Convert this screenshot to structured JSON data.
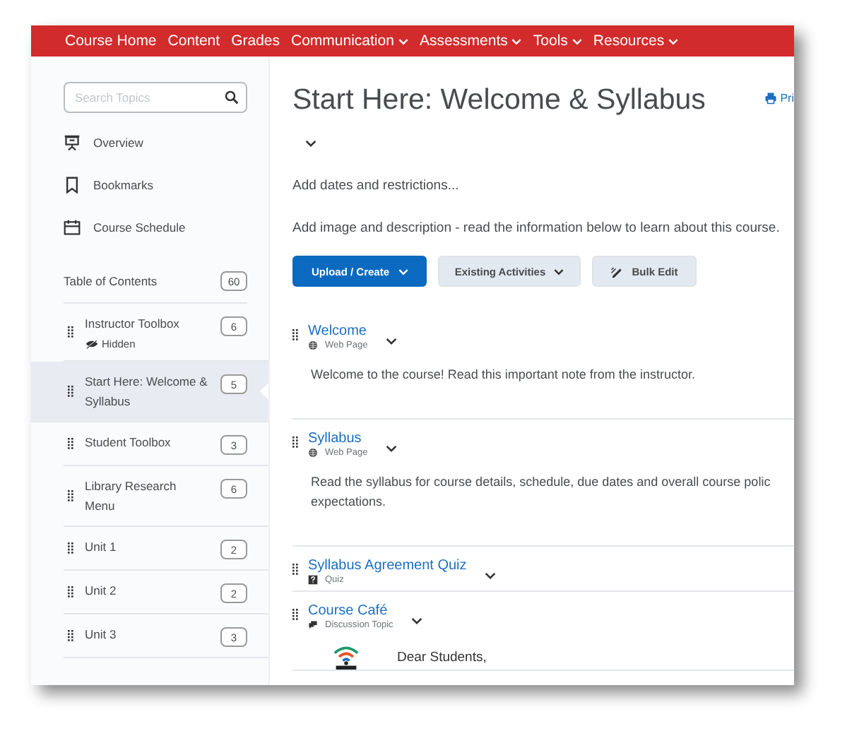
{
  "nav": [
    {
      "label": "Course Home",
      "menu": false
    },
    {
      "label": "Content",
      "menu": false
    },
    {
      "label": "Grades",
      "menu": false
    },
    {
      "label": "Communication",
      "menu": true
    },
    {
      "label": "Assessments",
      "menu": true
    },
    {
      "label": "Tools",
      "menu": true
    },
    {
      "label": "Resources",
      "menu": true
    }
  ],
  "sidebar": {
    "search": {
      "placeholder": "Search Topics"
    },
    "links": [
      {
        "label": "Overview",
        "kind": "presentation"
      },
      {
        "label": "Bookmarks",
        "kind": "bookmark"
      },
      {
        "label": "Course Schedule",
        "kind": "calendar"
      }
    ],
    "toc": {
      "label": "Table of Contents",
      "count": "60"
    },
    "modules": [
      {
        "label": "Instructor Toolbox",
        "count": "6",
        "hidden_label": "Hidden",
        "selected": false
      },
      {
        "label": "Start Here: Welcome & Syllabus",
        "count": "5",
        "selected": true
      },
      {
        "label": "Student Toolbox",
        "count": "3",
        "selected": false
      },
      {
        "label": "Library Research Menu",
        "count": "6",
        "selected": false
      },
      {
        "label": "Unit 1",
        "count": "2",
        "selected": false
      },
      {
        "label": "Unit 2",
        "count": "2",
        "selected": false
      },
      {
        "label": "Unit 3",
        "count": "3",
        "selected": false
      }
    ]
  },
  "main": {
    "title": "Start Here: Welcome & Syllabus",
    "print_label": "Pri",
    "dates_link": "Add dates and restrictions...",
    "description": "Add image and description -  read the information below to learn about this course.",
    "buttons": [
      {
        "label": "Upload / Create",
        "kind": "primary",
        "menu": true
      },
      {
        "label": "Existing Activities",
        "kind": "secondary",
        "menu": true
      },
      {
        "label": "Bulk Edit",
        "kind": "edit",
        "menu": false
      }
    ],
    "topics": [
      {
        "title": "Welcome",
        "type": "Web Page",
        "kind": "web",
        "lines": [
          "Welcome to the course! Read this important note from the instructor."
        ]
      },
      {
        "title": "Syllabus",
        "type": "Web Page",
        "kind": "web",
        "lines": [
          "Read the syllabus for course details, schedule, due dates and overall course polic",
          "expectations."
        ]
      },
      {
        "title": "Syllabus Agreement Quiz",
        "type": "Quiz",
        "kind": "quiz"
      },
      {
        "title": "Course Café",
        "type": "Discussion Topic",
        "kind": "discussion",
        "greeting": "Dear Students,"
      }
    ]
  }
}
